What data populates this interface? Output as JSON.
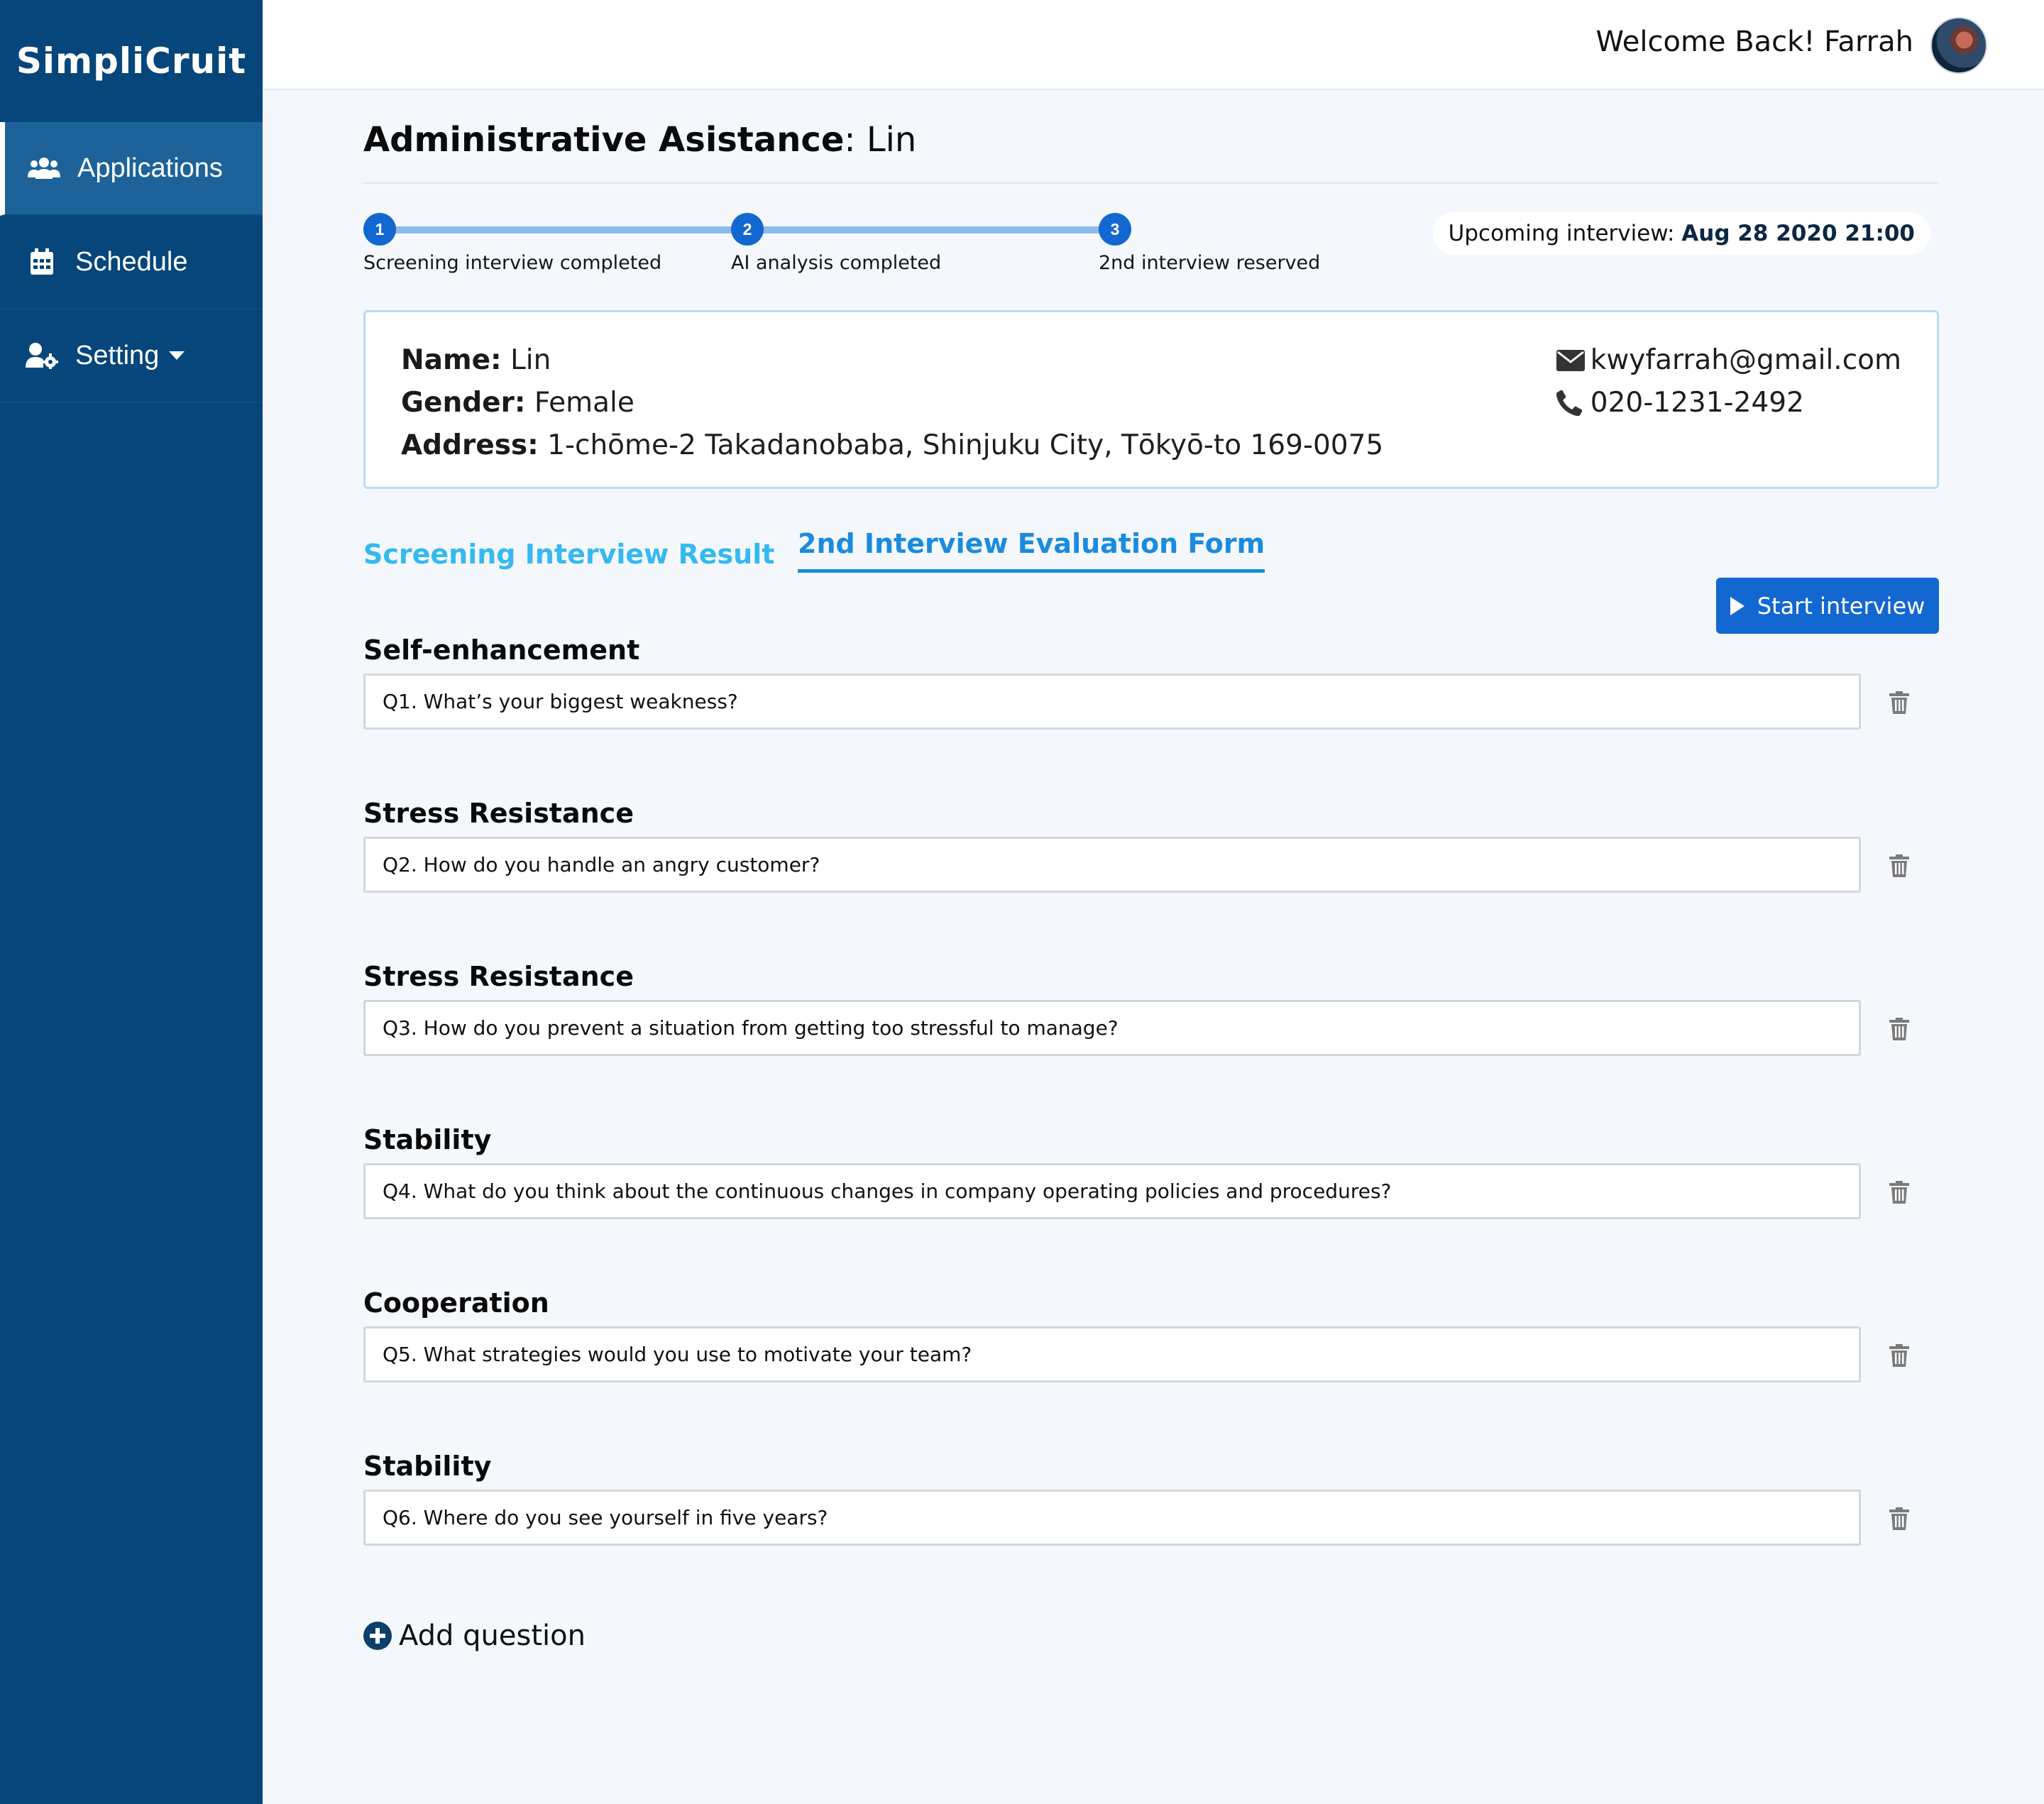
{
  "app": {
    "logo": "SimpliCruit"
  },
  "sidebar": {
    "items": [
      {
        "label": "Applications",
        "icon": "users-icon"
      },
      {
        "label": "Schedule",
        "icon": "calendar-icon"
      },
      {
        "label": "Setting",
        "icon": "user-cog-icon"
      }
    ]
  },
  "header": {
    "welcome": "Welcome Back! Farrah"
  },
  "page": {
    "title_bold": "Administrative Asistance",
    "title_rest": ": Lin"
  },
  "stepper": {
    "steps": [
      {
        "number": "1",
        "label": "Screening interview completed"
      },
      {
        "number": "2",
        "label": "AI analysis completed"
      },
      {
        "number": "3",
        "label": "2nd interview reserved"
      }
    ],
    "upcoming_label": "Upcoming interview:",
    "upcoming_value": "Aug 28 2020 21:00"
  },
  "candidate": {
    "name_label": "Name:",
    "name": "Lin",
    "gender_label": "Gender:",
    "gender": "Female",
    "address_label": "Address:",
    "address": "1-chōme-2 Takadanobaba, Shinjuku City, Tōkyō-to 169-0075",
    "email": "kwyfarrah@gmail.com",
    "phone": "020-1231-2492"
  },
  "tabs": [
    {
      "label": "Screening Interview Result"
    },
    {
      "label": "2nd Interview Evaluation Form"
    }
  ],
  "start_button": "Start interview",
  "questions": [
    {
      "category": "Self-enhancement",
      "text": "Q1. What’s your biggest weakness?"
    },
    {
      "category": "Stress Resistance",
      "text": "Q2. How do you handle an angry customer?"
    },
    {
      "category": "Stress Resistance",
      "text": "Q3. How do you prevent a situation from getting too stressful to manage?"
    },
    {
      "category": "Stability",
      "text": "Q4. What do you think about the continuous changes in company operating policies and procedures?"
    },
    {
      "category": "Cooperation",
      "text": "Q5. What strategies would you use to motivate your team?"
    },
    {
      "category": "Stability",
      "text": "Q6. Where do you see yourself in five years?"
    }
  ],
  "add_question": "Add question",
  "colors": {
    "sidebar": "#06467a",
    "sidebar_active": "#1d6399",
    "primary": "#1367d1",
    "tab_active": "#1a8bdf",
    "tab_inactive": "#35b9ef",
    "background": "#f4f8fc"
  }
}
